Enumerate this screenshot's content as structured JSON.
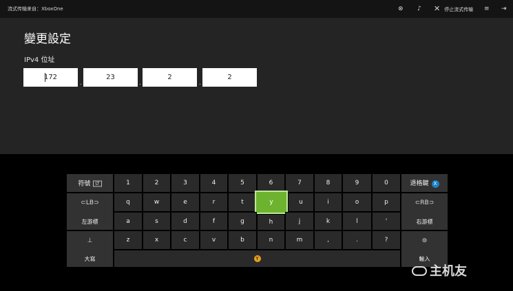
{
  "titlebar": {
    "app_title": "流式传输来自：XboxOne",
    "icons": [
      "xbox-icon",
      "controller-icon",
      "close-icon",
      "menu-icon",
      "collapse-icon"
    ],
    "stop_label": "停止流式传输"
  },
  "page": {
    "title": "變更設定",
    "field_label": "IPv4 位址",
    "ip": [
      "172",
      "23",
      "2",
      "2"
    ]
  },
  "keyboard": {
    "symbols_label": "符號",
    "symbols_badge": "LT",
    "backspace_label": "退格鍵",
    "left_cursor_label": "左游標",
    "right_cursor_label": "右游標",
    "caps_label": "大寫",
    "enter_label": "輸入",
    "selected_key": "y",
    "row1": [
      "1",
      "2",
      "3",
      "4",
      "5",
      "6",
      "7",
      "8",
      "9",
      "0"
    ],
    "row2": [
      "q",
      "w",
      "e",
      "r",
      "t",
      "y",
      "u",
      "i",
      "o",
      "p"
    ],
    "row3": [
      "a",
      "s",
      "d",
      "f",
      "g",
      "h",
      "j",
      "k",
      "l",
      "'"
    ],
    "row4": [
      "z",
      "x",
      "c",
      "v",
      "b",
      "n",
      "m",
      ",",
      ".",
      "?"
    ],
    "space_button": "Y"
  },
  "watermark": "主机友",
  "colors": {
    "selected": "#6eb330",
    "ip_box": "#ffffff",
    "content_bg": "#242424"
  }
}
